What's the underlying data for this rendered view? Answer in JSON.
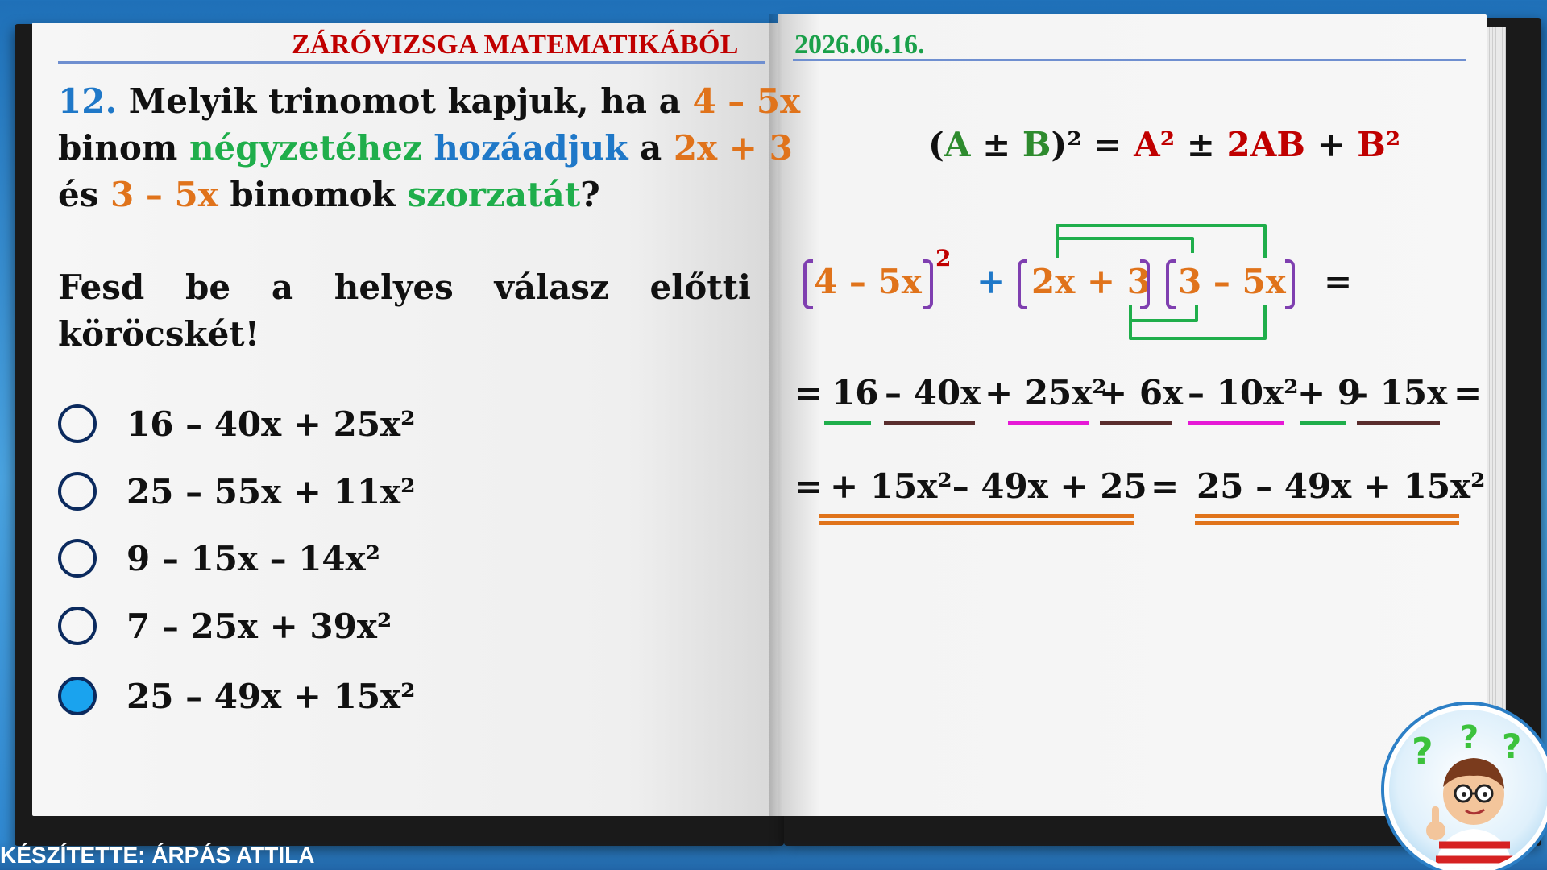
{
  "header": {
    "title": "ZÁRÓVIZSGA MATEMATIKÁBÓL",
    "date": "2026.06.16."
  },
  "question": {
    "number": "12.",
    "line1_a": " Melyik trinomot kapjuk, ha a ",
    "line1_b": "4 – 5x",
    "line2_a": "binom ",
    "line2_b": "négyzetéhez",
    "line2_c": " ",
    "line2_d": "hozáadjuk",
    "line2_e": " a ",
    "line2_f": "2x + 3",
    "line3_a": "és ",
    "line3_b": "3 – 5x",
    "line3_c": " binomok ",
    "line3_d": "szorzatát",
    "line3_e": "?"
  },
  "instruction": {
    "words": [
      "Fesd",
      "be",
      "a",
      "helyes",
      "válasz",
      "előtti"
    ],
    "line2": "köröcskét!"
  },
  "options": [
    {
      "label": "16 – 40x + 25x²",
      "selected": false
    },
    {
      "label": "25 – 55x + 11x²",
      "selected": false
    },
    {
      "label": "9 – 15x – 14x²",
      "selected": false
    },
    {
      "label": "7 – 25x + 39x²",
      "selected": false
    },
    {
      "label": "25 – 49x + 15x²",
      "selected": true
    }
  ],
  "formula": {
    "open": "(",
    "a": "A",
    "pm": " ± ",
    "b": "B",
    "close": ")² = ",
    "a2": "A²",
    "pm2": " ± ",
    "ab": "2AB",
    "plus": " + ",
    "b2": "B²"
  },
  "expression": {
    "term1": "4 – 5x",
    "exp": "2",
    "plus": "+",
    "term2": "2x + 3",
    "term3": "3 – 5x",
    "equals": "="
  },
  "expansion": {
    "eq": "=",
    "t1": "16",
    "t2": "– 40x",
    "t3": "+ 25x²",
    "t4": "+ 6x",
    "t5": "– 10x²",
    "t6": "+ 9",
    "t7": "– 15x",
    "end": "="
  },
  "result": {
    "eq1": "=",
    "left": "+ 15x²–  49x + 25",
    "eq2": "=",
    "right": "25 – 49x + 15x²"
  },
  "footer": "KÉSZÍTETTE: ÁRPÁS ATTILA",
  "colors": {
    "title_red": "#c00000",
    "date_green": "#1aa04a",
    "orange": "#e0731b",
    "green": "#1fae4b",
    "blue": "#1f78c8",
    "purple": "#7f3fb0",
    "magenta": "#e619d6",
    "brown": "#5a2d2d",
    "selected_fill": "#1aa3ee"
  },
  "mascot": {
    "icon": "thinking-boy-icon"
  }
}
